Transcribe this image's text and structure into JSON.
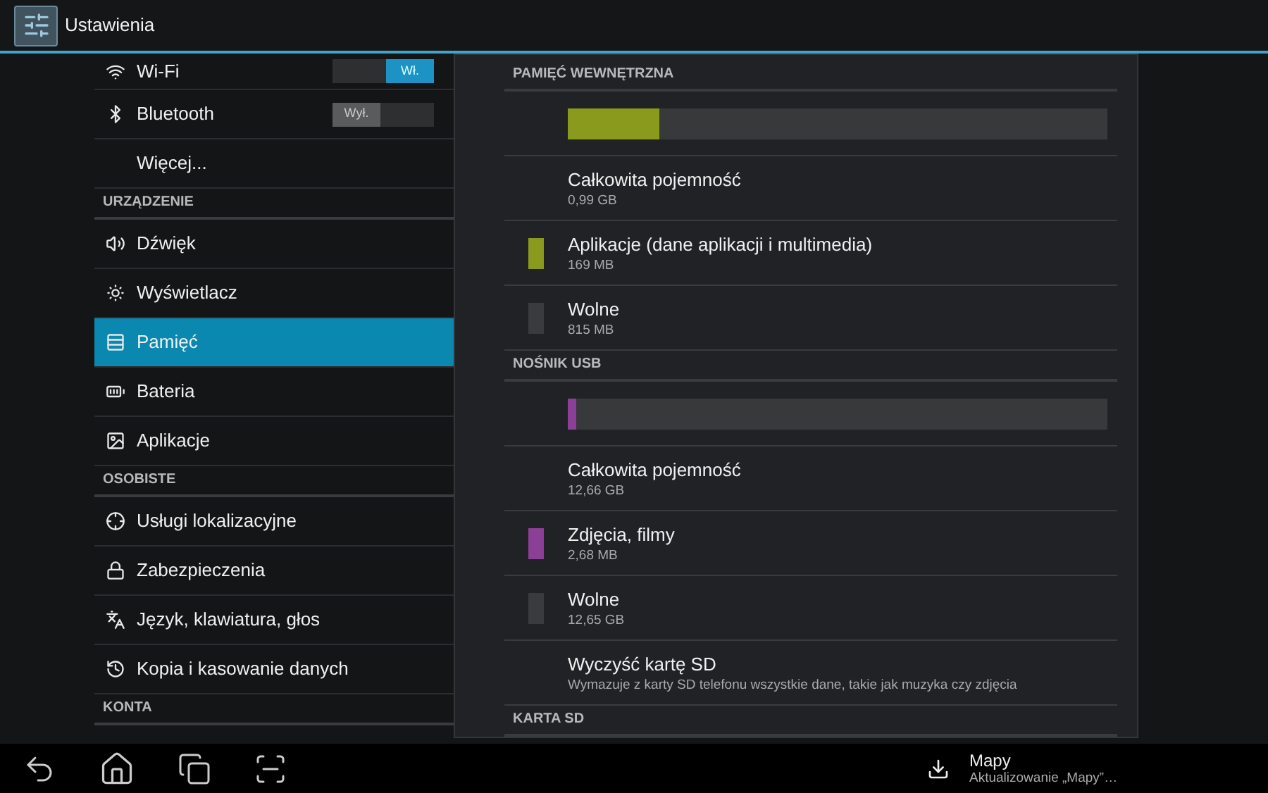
{
  "action_bar": {
    "title": "Ustawienia"
  },
  "sidebar": {
    "items": [
      {
        "kind": "item",
        "label": "Wi-Fi",
        "selected": false,
        "toggle": {
          "on": true,
          "label": "Wł."
        }
      },
      {
        "kind": "item",
        "label": "Bluetooth",
        "selected": false,
        "toggle": {
          "on": false,
          "label": "Wył."
        }
      },
      {
        "kind": "item",
        "label": "Więcej...",
        "selected": false
      },
      {
        "kind": "header",
        "label": "URZĄDZENIE"
      },
      {
        "kind": "item",
        "label": "Dźwięk",
        "selected": false
      },
      {
        "kind": "item",
        "label": "Wyświetlacz",
        "selected": false
      },
      {
        "kind": "item",
        "label": "Pamięć",
        "selected": true
      },
      {
        "kind": "item",
        "label": "Bateria",
        "selected": false
      },
      {
        "kind": "item",
        "label": "Aplikacje",
        "selected": false
      },
      {
        "kind": "header",
        "label": "OSOBISTE"
      },
      {
        "kind": "item",
        "label": "Usługi lokalizacyjne",
        "selected": false
      },
      {
        "kind": "item",
        "label": "Zabezpieczenia",
        "selected": false
      },
      {
        "kind": "item",
        "label": "Język, klawiatura, głos",
        "selected": false
      },
      {
        "kind": "item",
        "label": "Kopia i kasowanie danych",
        "selected": false
      },
      {
        "kind": "header",
        "label": "KONTA"
      }
    ]
  },
  "storage": {
    "sections": [
      {
        "title": "PAMIĘĆ WEWNĘTRZNA",
        "bar": {
          "level": 0.17,
          "color": "#8a9a1c"
        },
        "rows": [
          {
            "kind": "total",
            "title": "Całkowita pojemność",
            "summary": "0,99 GB"
          },
          {
            "kind": "category",
            "title": "Aplikacje (dane aplikacji i multimedia)",
            "summary": "169 MB",
            "color": "#8a9a1c"
          },
          {
            "kind": "category",
            "title": "Wolne",
            "summary": "815 MB",
            "color": "#3a3b3d"
          }
        ]
      },
      {
        "title": "NOŚNIK USB",
        "bar": {
          "level": 0.015,
          "color": "#8c3f96"
        },
        "rows": [
          {
            "kind": "total",
            "title": "Całkowita pojemność",
            "summary": "12,66 GB"
          },
          {
            "kind": "category",
            "title": "Zdjęcia, filmy",
            "summary": "2,68 MB",
            "color": "#8c3f96"
          },
          {
            "kind": "category",
            "title": "Wolne",
            "summary": "12,65 GB",
            "color": "#3a3b3d"
          },
          {
            "kind": "action",
            "title": "Wyczyść kartę SD",
            "summary": "Wymazuje z karty SD telefonu wszystkie dane, takie jak muzyka czy zdjęcia"
          }
        ]
      },
      {
        "title": "KARTA SD"
      }
    ]
  },
  "notification": {
    "title": "Mapy",
    "text": "Aktualizowanie „Mapy”…"
  }
}
